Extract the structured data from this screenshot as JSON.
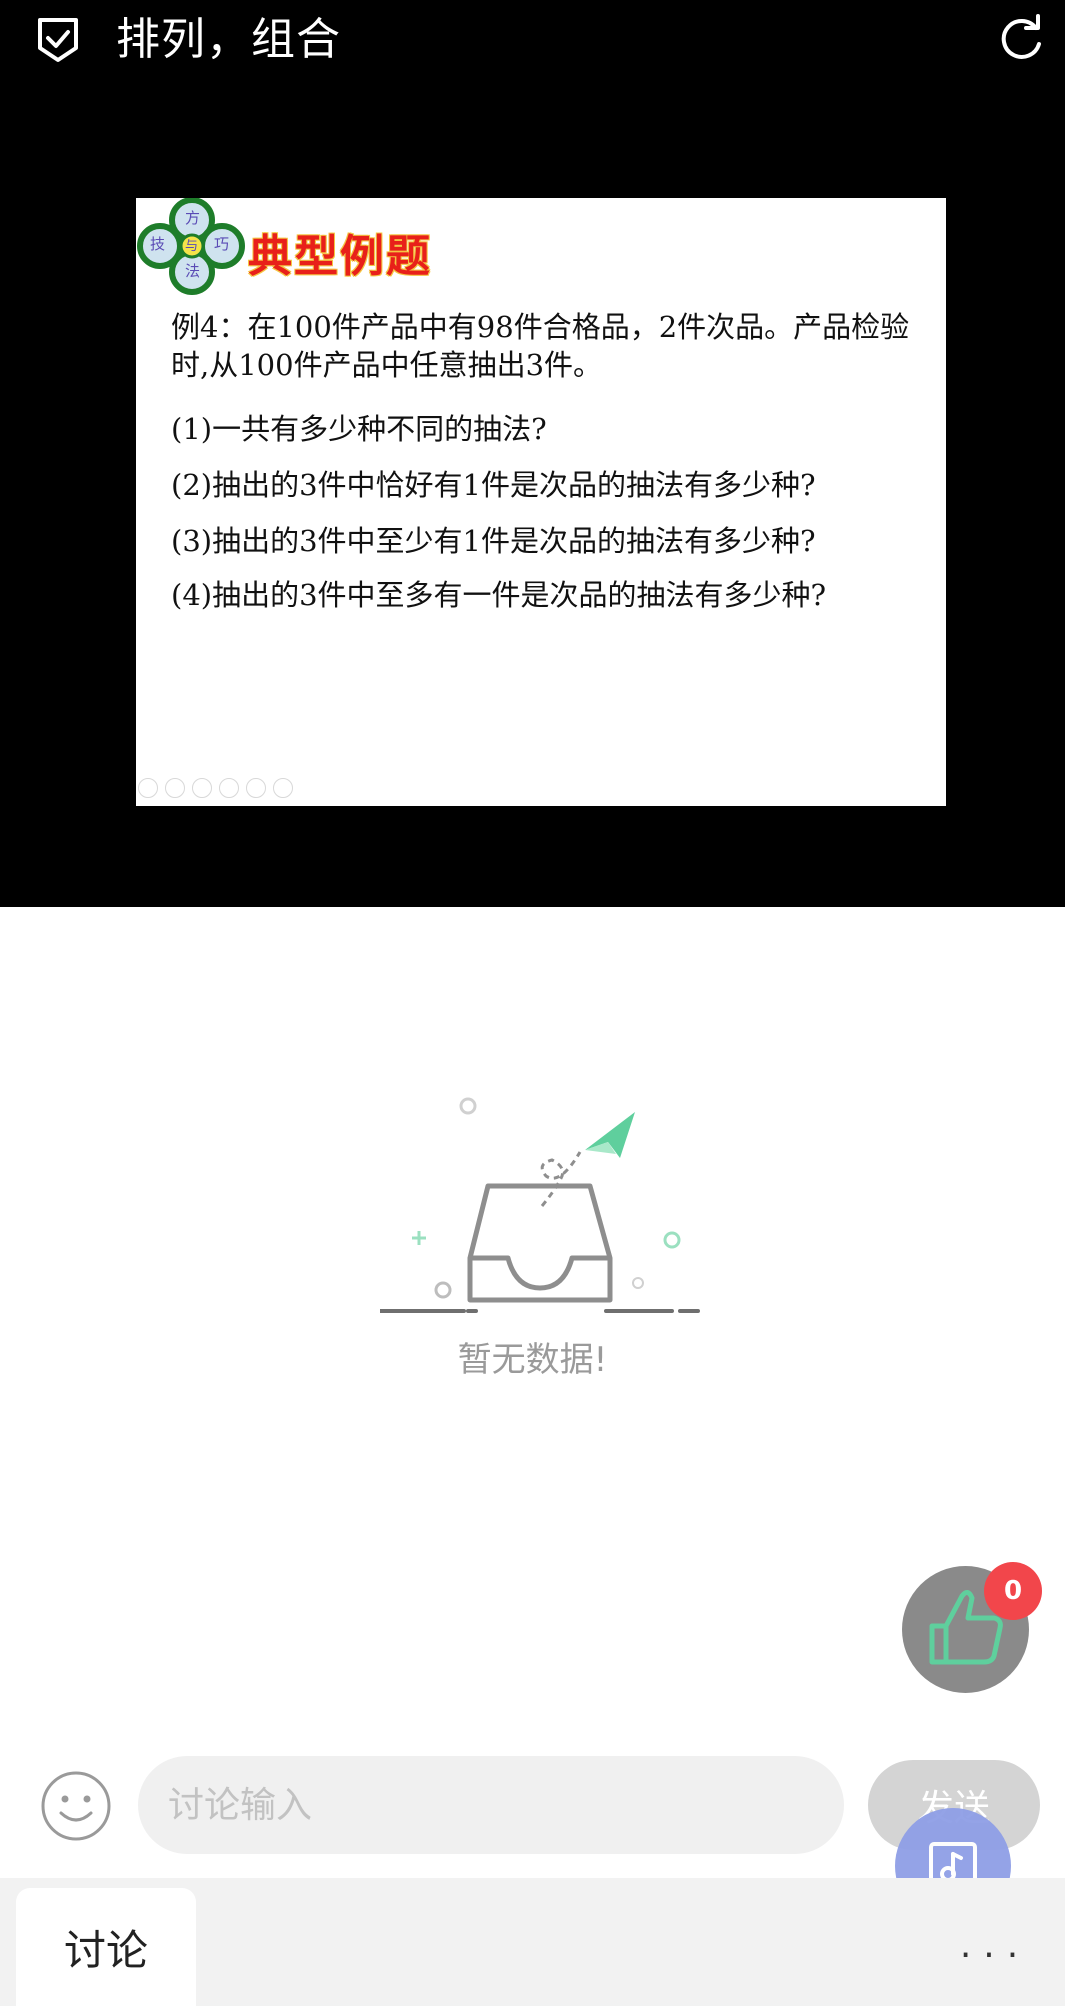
{
  "header": {
    "title": "排列，组合",
    "icons": {
      "left": "shield-check-icon",
      "right": "refresh-icon"
    }
  },
  "slide": {
    "badge": {
      "chars": [
        "方",
        "技",
        "与",
        "巧",
        "法"
      ]
    },
    "heading": "典型例题",
    "example_intro": "例4：在100件产品中有98件合格品，2件次品。产品检验时,从100件产品中任意抽出3件。",
    "questions": [
      "(1)一共有多少种不同的抽法?",
      "(2)抽出的3件中恰好有1件是次品的抽法有多少种?",
      "(3)抽出的3件中至少有1件是次品的抽法有多少种?",
      "(4)抽出的3件中至多有一件是次品的抽法有多少种?"
    ]
  },
  "empty_state": {
    "text": "暂无数据!",
    "icon": "empty-inbox-icon"
  },
  "like": {
    "count": "0",
    "icon": "thumbs-up-icon"
  },
  "composer": {
    "placeholder": "讨论输入",
    "send_label": "发送",
    "emoji_icon": "smiley-icon",
    "music_icon": "music-note-icon"
  },
  "tabs": {
    "active": "讨论",
    "more_label": "···"
  },
  "colors": {
    "accent_green": "#5fcf9d",
    "badge_red": "#f2464b",
    "heading_red": "#e8201a",
    "music_blue": "#8f9fe6"
  }
}
